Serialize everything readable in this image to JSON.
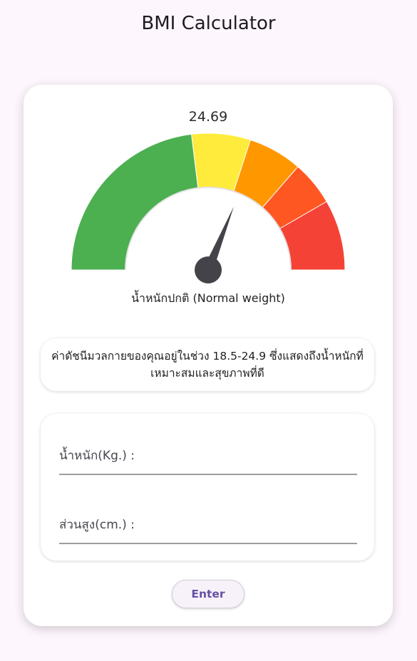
{
  "header": {
    "title": "BMI Calculator"
  },
  "result": {
    "bmi_value": "24.69",
    "category_label": "น้ำหนักปกติ (Normal weight)",
    "description": "ค่าดัชนีมวลกายของคุณอยู่ในช่วง 18.5-24.9 ซึ่งแสดงถึงน้ำหนักที่เหมาะสมและสุขภาพที่ดี"
  },
  "gauge": {
    "value": 24.69,
    "segments": [
      {
        "name": "normal",
        "color": "#4caf50"
      },
      {
        "name": "overweight",
        "color": "#ffeb3b"
      },
      {
        "name": "obese-1",
        "color": "#ff9800"
      },
      {
        "name": "obese-2",
        "color": "#ff5722"
      },
      {
        "name": "obese-3",
        "color": "#f44336"
      }
    ],
    "needle_color": "#45434a"
  },
  "form": {
    "weight_label": "น้ำหนัก(Kg.) :",
    "weight_value": "",
    "height_label": "ส่วนสูง(cm.) :",
    "height_value": ""
  },
  "actions": {
    "enter_label": "Enter"
  },
  "colors": {
    "background": "#fdf6fc",
    "accent": "#6750a4"
  }
}
